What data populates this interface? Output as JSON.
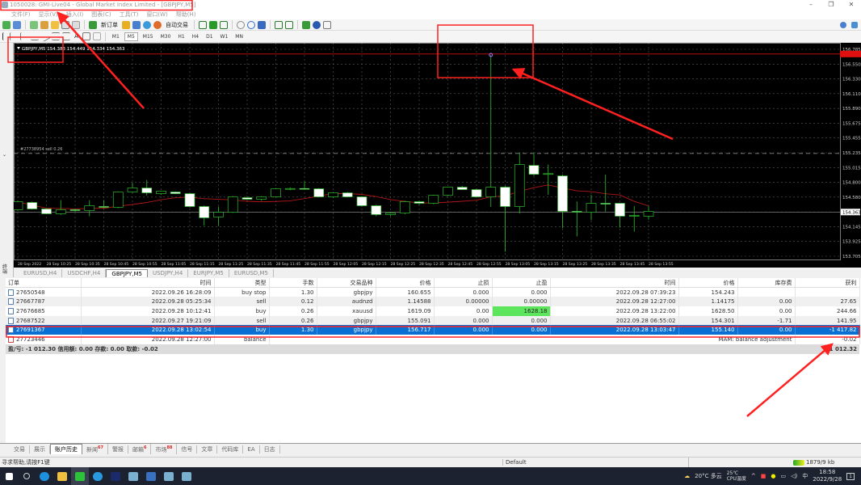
{
  "window": {
    "title": "1050028: GMI-Live04 - Global Market Index Limited - [GBPJPY,M5]",
    "minimize": "–",
    "maximize": "❐",
    "close": "✕"
  },
  "menu": [
    "文件(F)",
    "显示(V)",
    "插入(I)",
    "图表(C)",
    "工具(T)",
    "窗口(W)",
    "帮助(H)"
  ],
  "toolbar": {
    "new_order": "新订单",
    "auto_trading": "自动交易",
    "timeframes": [
      "M1",
      "M5",
      "M15",
      "M30",
      "H1",
      "H4",
      "D1",
      "W1",
      "MN"
    ],
    "active_timeframe": "M5",
    "text_tool": "A"
  },
  "chart": {
    "header": "GBPJPY,M5  154.383 154.449 154.334 154.363",
    "order_label": "#27738954 sell 0.26",
    "bid": 154.363,
    "alert_line": 156.715,
    "order_line": 155.235,
    "price_axis": [
      "156.785",
      "156.550",
      "156.330",
      "156.110",
      "155.890",
      "155.675",
      "155.455",
      "155.235",
      "155.015",
      "154.800",
      "154.580",
      "154.363",
      "154.145",
      "153.925",
      "153.705"
    ],
    "price_range": [
      153.705,
      156.785
    ],
    "time_labels": [
      "28 Sep 2022",
      "28 Sep 10:25",
      "28 Sep 10:35",
      "28 Sep 10:45",
      "28 Sep 10:55",
      "28 Sep 11:05",
      "28 Sep 11:15",
      "28 Sep 11:25",
      "28 Sep 11:35",
      "28 Sep 11:45",
      "28 Sep 11:55",
      "28 Sep 12:05",
      "28 Sep 12:15",
      "28 Sep 12:25",
      "28 Sep 12:35",
      "28 Sep 12:45",
      "28 Sep 12:55",
      "28 Sep 13:05",
      "28 Sep 13:15",
      "28 Sep 13:25",
      "28 Sep 13:35",
      "28 Sep 13:45",
      "28 Sep 13:55"
    ],
    "candles_ohlc": [
      [
        154.397,
        154.53,
        154.38,
        154.517
      ],
      [
        154.505,
        154.52,
        154.4,
        154.409
      ],
      [
        154.409,
        154.42,
        154.33,
        154.337
      ],
      [
        154.337,
        154.541,
        154.32,
        154.397
      ],
      [
        154.397,
        154.41,
        154.36,
        154.385
      ],
      [
        154.385,
        154.541,
        154.3,
        154.457
      ],
      [
        154.445,
        154.541,
        154.42,
        154.433
      ],
      [
        154.433,
        154.67,
        154.42,
        154.661
      ],
      [
        154.661,
        154.8,
        154.65,
        154.721
      ],
      [
        154.721,
        154.84,
        154.61,
        154.649
      ],
      [
        154.637,
        154.68,
        154.62,
        154.673
      ],
      [
        154.661,
        154.67,
        154.63,
        154.637
      ],
      [
        154.637,
        154.65,
        154.43,
        154.445
      ],
      [
        154.445,
        154.46,
        154.16,
        154.277
      ],
      [
        154.289,
        154.445,
        154.16,
        154.361
      ],
      [
        154.361,
        154.6,
        154.35,
        154.589
      ],
      [
        154.577,
        154.6,
        154.54,
        154.553
      ],
      [
        154.553,
        154.6,
        154.53,
        154.589
      ],
      [
        154.589,
        154.72,
        154.58,
        154.709
      ],
      [
        154.709,
        154.73,
        154.69,
        154.713
      ],
      [
        154.713,
        154.82,
        154.7,
        154.709
      ],
      [
        154.709,
        154.72,
        154.58,
        154.589
      ],
      [
        154.589,
        154.66,
        154.57,
        154.649
      ],
      [
        154.649,
        154.66,
        154.58,
        154.589
      ],
      [
        154.589,
        154.6,
        154.44,
        154.457
      ],
      [
        154.457,
        154.47,
        154.3,
        154.325
      ],
      [
        154.325,
        154.36,
        154.3,
        154.349
      ],
      [
        154.349,
        154.53,
        154.33,
        154.517
      ],
      [
        154.517,
        154.53,
        154.47,
        154.493
      ],
      [
        154.493,
        154.62,
        154.48,
        154.613
      ],
      [
        154.613,
        154.74,
        154.6,
        154.733
      ],
      [
        154.733,
        154.75,
        154.69,
        154.697
      ],
      [
        154.697,
        154.71,
        154.58,
        154.589
      ],
      [
        154.589,
        156.701,
        154.44,
        154.733
      ],
      [
        154.733,
        154.75,
        153.773,
        154.445
      ],
      [
        154.445,
        155.25,
        154.34,
        155.069
      ],
      [
        155.057,
        155.25,
        154.9,
        154.925
      ],
      [
        154.925,
        155.07,
        154.62,
        154.935
      ],
      [
        154.901,
        154.92,
        154.121,
        154.373
      ],
      [
        154.373,
        154.52,
        154.0,
        154.361
      ],
      [
        154.361,
        154.62,
        154.24,
        154.493
      ],
      [
        154.493,
        154.92,
        154.37,
        154.481
      ],
      [
        154.493,
        154.5,
        154.13,
        154.301
      ],
      [
        154.301,
        154.45,
        154.07,
        154.313
      ],
      [
        154.301,
        154.45,
        154.25,
        154.373
      ]
    ],
    "colors": {
      "background": "#000000",
      "grid": "#5a5a5a",
      "candle_outline": "#2fbf2f",
      "bear_fill": "#ffffff",
      "bull_fill": "#000000",
      "ma": "#b01818",
      "alert_line": "#d01010"
    }
  },
  "chart_tabs": [
    "EURUSD,H4",
    "USDCHF,H4",
    "GBPJPY,M5",
    "USDJPY,H4",
    "EURJPY,M5",
    "EURUSD,M5"
  ],
  "active_chart_tab": "GBPJPY,M5",
  "history": {
    "columns": [
      "订单",
      "时间",
      "类型",
      "手数",
      "交易品种",
      "价格",
      "止损",
      "止盈",
      "时间",
      "价格",
      "库存费",
      "获利"
    ],
    "rows": [
      [
        "27650548",
        "2022.09.26 16:28:09",
        "buy stop",
        "1.30",
        "gbpjpy",
        "160.655",
        "0.000",
        "0.000",
        "2022.09.28 07:39:23",
        "154.243",
        "",
        ""
      ],
      [
        "27667787",
        "2022.09.28 05:25:34",
        "sell",
        "0.12",
        "audnzd",
        "1.14588",
        "0.00000",
        "0.00000",
        "2022.09.28 12:27:00",
        "1.14175",
        "0.00",
        "27.65"
      ],
      [
        "27676685",
        "2022.09.28 10:12:41",
        "buy",
        "0.26",
        "xauusd",
        "1619.09",
        "0.00",
        "1628.18",
        "2022.09.28 13:22:00",
        "1628.50",
        "0.00",
        "244.66"
      ],
      [
        "27687522",
        "2022.09.27 19:21:09",
        "sell",
        "0.26",
        "gbpjpy",
        "155.091",
        "0.000",
        "0.000",
        "2022.09.28 06:55:02",
        "154.301",
        "-1.71",
        "141.95"
      ],
      [
        "27691367",
        "2022.09.28 13:02:54",
        "buy",
        "1.30",
        "gbpjpy",
        "156.717",
        "0.000",
        "0.000",
        "2022.09.28 13:03:47",
        "155.140",
        "0.00",
        "-1 417.82"
      ]
    ],
    "balance_row": {
      "order": "27723446",
      "time": "2022.09.28 12:27:00",
      "type": "balance",
      "comment": "MAM: balance adjustment",
      "profit": "-0.02"
    },
    "summary": "盈/亏: -1 012.30  信用额: 0.00  存款: 0.00  取款: -0.02",
    "summary_total": "-1 012.32",
    "selected_order": "27691367"
  },
  "terminal_tabs": [
    {
      "label": "交易"
    },
    {
      "label": "展示"
    },
    {
      "label": "账户历史"
    },
    {
      "label": "新闻",
      "badge": "67"
    },
    {
      "label": "警报"
    },
    {
      "label": "邮箱",
      "badge": "6"
    },
    {
      "label": "市场",
      "badge": "88"
    },
    {
      "label": "信号"
    },
    {
      "label": "文章"
    },
    {
      "label": "代码库"
    },
    {
      "label": "EA"
    },
    {
      "label": "日志"
    }
  ],
  "active_terminal_tab": "账户历史",
  "terminal_side_label": "终端",
  "status": {
    "help": "寻求帮助,请按F1键",
    "profile": "Default",
    "traffic": "1879/9 kb"
  },
  "taskbar": {
    "weather": "20°C 多云",
    "cpu_temp": "25℃",
    "cpu_label": "CPU温度",
    "ime": "中",
    "time": "18:58",
    "date": "2022/9/28",
    "notifications": "1"
  }
}
